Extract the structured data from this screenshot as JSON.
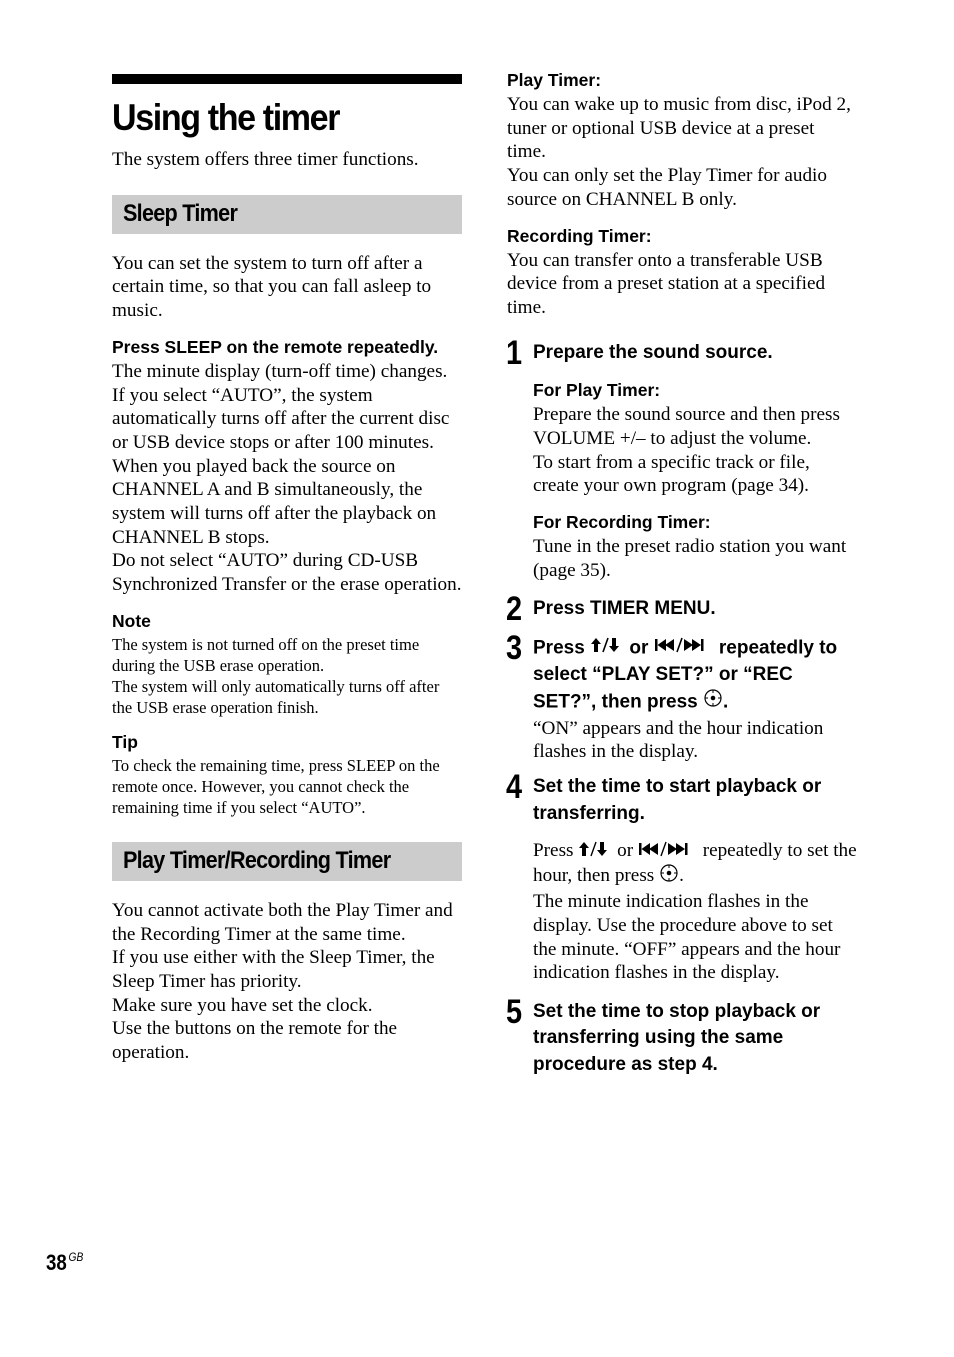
{
  "page": {
    "title": "Using the timer",
    "intro": "The system offers three timer functions.",
    "page_number": "38",
    "page_suffix": "GB"
  },
  "sleep_timer": {
    "heading": "Sleep Timer",
    "description": "You can set the system to turn off after a certain time, so that you can fall asleep to music.",
    "instruction": "Press SLEEP on the remote repeatedly.",
    "body": [
      "The minute display (turn-off time) changes.",
      "If you select “AUTO”, the system automatically turns off after the current disc or USB device stops or after 100 minutes. When you played back the source on CHANNEL A and B simultaneously, the system will turns off after the playback on CHANNEL B stops.",
      "Do not select “AUTO” during CD-USB Synchronized Transfer or the erase operation."
    ],
    "note_label": "Note",
    "note": [
      "The system is not turned off on the preset time during the USB erase operation.",
      "The system will only automatically turns off after the USB erase operation finish."
    ],
    "tip_label": "Tip",
    "tip": "To check the remaining time, press SLEEP on the remote once. However, you cannot check the remaining time if you select “AUTO”."
  },
  "play_recording_timer": {
    "heading": "Play Timer/Recording Timer",
    "body": [
      "You cannot activate both the Play Timer and the Recording Timer at the same time.",
      "If you use either with the Sleep Timer, the Sleep Timer has priority.",
      "Make sure you have set the clock.",
      "Use the buttons on the remote for the operation."
    ],
    "play_timer_label": "Play Timer:",
    "play_timer_text": [
      "You can wake up to music from disc, iPod 2, tuner or optional USB device at a preset time.",
      "You can only set the Play Timer for audio source on CHANNEL B only."
    ],
    "recording_timer_label": "Recording Timer:",
    "recording_timer_text": "You can transfer onto a transferable USB device from a preset station at a specified time."
  },
  "steps": [
    {
      "number": "1",
      "title": "Prepare the sound source.",
      "for_play_label": "For Play Timer:",
      "for_play_text": [
        "Prepare the sound source and then press VOLUME +/– to adjust the volume.",
        "To start from a specific track or file, create your own program (page 34)."
      ],
      "for_rec_label": "For Recording Timer:",
      "for_rec_text": "Tune in the preset radio station you want (page 35)."
    },
    {
      "number": "2",
      "title": "Press TIMER MENU."
    },
    {
      "number": "3",
      "title_a": "Press",
      "title_or": "or",
      "title_b": "repeatedly to select “PLAY SET?” or “REC SET?”, then press",
      "title_end": ".",
      "body": "“ON” appears and the hour indication flashes in the display."
    },
    {
      "number": "4",
      "title": "Set the time to start playback or transferring.",
      "body_a": "Press",
      "body_or": "or",
      "body_b": "repeatedly to set the hour, then press",
      "body_end": ".",
      "body2": "The minute indication flashes in the display. Use the procedure above to set the minute. “OFF” appears and the hour indication flashes in the display."
    },
    {
      "number": "5",
      "title": "Set the time to stop playback or transferring using the same procedure as step 4."
    }
  ],
  "icons": {
    "up_down": "up-down-arrow-icon",
    "prev_next": "prev-next-track-icon",
    "enter": "enter-button-icon"
  }
}
